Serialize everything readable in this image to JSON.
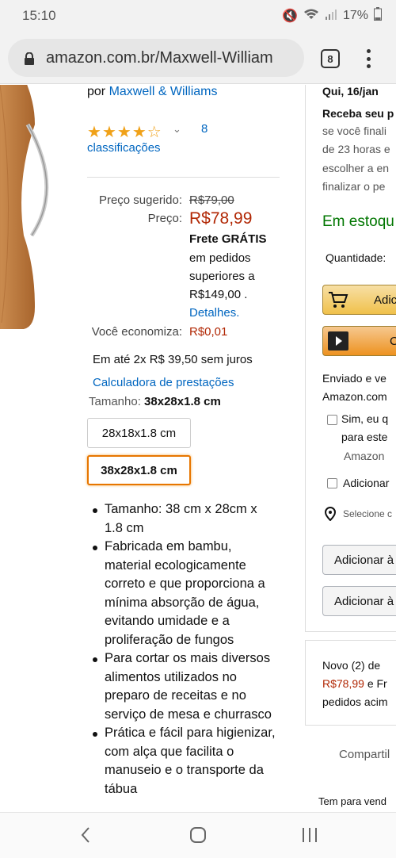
{
  "status": {
    "time": "15:10",
    "battery": "17%"
  },
  "browser": {
    "url": "amazon.com.br/Maxwell-William",
    "tab_count": "8"
  },
  "product": {
    "by_prefix": "por",
    "brand": "Maxwell & Williams",
    "rating_stars": 4,
    "rating_count": "8",
    "rating_label": "classificações",
    "suggested_label": "Preço sugerido:",
    "suggested_value": "R$79,00",
    "price_label": "Preço:",
    "price_value": "R$78,99",
    "shipping_title": "Frete GRÁTIS",
    "shipping_line1": "em pedidos",
    "shipping_line2": "superiores a",
    "shipping_line3": "R$149,00 .",
    "shipping_details": "Detalhes.",
    "savings_label": "Você economiza:",
    "savings_value": "R$0,01",
    "installments": "Em até 2x R$ 39,50 sem juros",
    "calculator_link": "Calculadora de prestações",
    "size_label": "Tamanho:",
    "size_selected": "38x28x1.8 cm",
    "sizes": [
      "28x18x1.8 cm",
      "38x28x1.8 cm"
    ],
    "bullets": [
      "Tamanho: 38 cm x 28cm x 1.8 cm",
      "Fabricada em bambu, material ecologicamente correto e que proporciona a mínima absorção de água, evitando umidade e a proliferação de fungos",
      "Para cortar os mais diversos alimentos utilizados no preparo de receitas e no serviço de mesa e churrasco",
      "Prática e fácil para higienizar, com alça que facilita o manuseio e o transporte da tábua"
    ]
  },
  "buybox": {
    "delivery_date": "Qui, 16/jan",
    "receive_line": "Receba seu p",
    "line1": "se você finali",
    "line2": "de 23 horas e",
    "line3": "escolher a en",
    "line4": "finalizar o pe",
    "stock": "Em estoqu",
    "quantity_label": "Quantidade:",
    "add_to_cart": "Adic",
    "buy_now": "C",
    "sold_by_1": "Enviado e ve",
    "sold_by_2": "Amazon.com",
    "prime_checkbox": "Sim, eu q",
    "prime_line2": "para este",
    "prime_link": "Amazon",
    "gift_checkbox": "Adicionar",
    "location_link": "Selecione c",
    "add_list_1": "Adicionar à",
    "add_list_2": "Adicionar à",
    "new_offers": "Novo (2) de",
    "offer_price": "R$78,99",
    "offer_tail": " e Fr",
    "offer_line3": "pedidos acim",
    "share": "Compartil",
    "sell_prompt": "Tem para vend"
  },
  "colors": {
    "price": "#b12704",
    "link": "#0066c0",
    "stock": "#007600",
    "cart": "#f0c14b",
    "buy": "#ed9220"
  }
}
